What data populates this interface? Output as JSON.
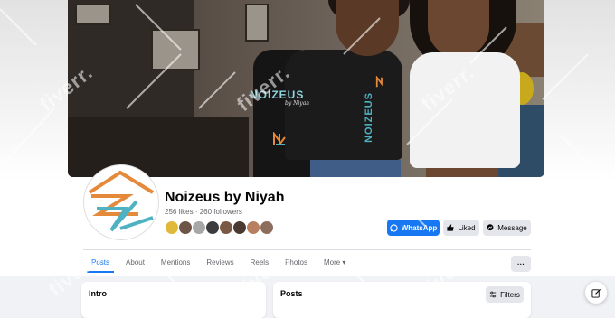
{
  "page": {
    "name": "Noizeus by Niyah",
    "likes": "256 likes",
    "followers": "260 followers",
    "separator": "·"
  },
  "cover_image": {
    "shirt_brand_left": "NOIZEUS",
    "shirt_brand_left_sub": "by Niyah",
    "shirt_brand_right": "NOIZEUS"
  },
  "actions": {
    "whatsapp": "WhatsApp",
    "liked": "Liked",
    "message": "Message",
    "more": "···"
  },
  "tabs": [
    {
      "label": "Posts",
      "active": true
    },
    {
      "label": "About"
    },
    {
      "label": "Mentions"
    },
    {
      "label": "Reviews"
    },
    {
      "label": "Reels"
    },
    {
      "label": "Photos"
    },
    {
      "label": "More ▾"
    }
  ],
  "sections": {
    "intro_title": "Intro",
    "posts_title": "Posts",
    "filters_label": "Filters"
  },
  "watermark": "fiverr.",
  "colors": {
    "accent": "#1877f2",
    "logo_orange": "#e58a3a",
    "logo_teal": "#4fb2c2"
  },
  "icons": [
    "whatsapp-icon",
    "thumbs-up-icon",
    "messenger-icon",
    "filters-icon",
    "edit-compose-icon"
  ]
}
